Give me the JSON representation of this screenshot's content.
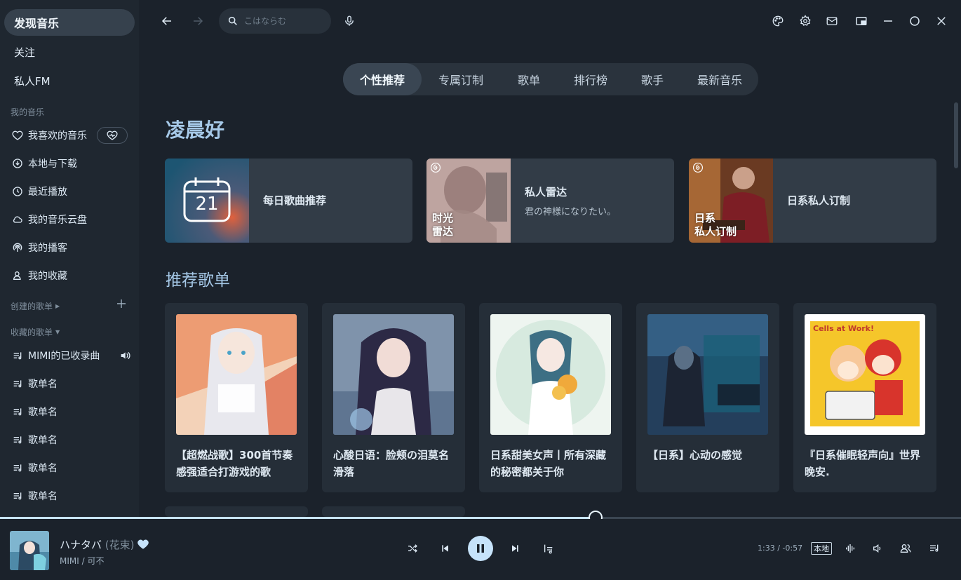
{
  "sidebar": {
    "nav": [
      {
        "label": "发现音乐",
        "active": true
      },
      {
        "label": "关注",
        "active": false
      },
      {
        "label": "私人FM",
        "active": false
      }
    ],
    "my_music_label": "我的音乐",
    "my_music": [
      {
        "label": "我喜欢的音乐",
        "icon": "heart-icon"
      },
      {
        "label": "本地与下载",
        "icon": "download-icon"
      },
      {
        "label": "最近播放",
        "icon": "clock-icon"
      },
      {
        "label": "我的音乐云盘",
        "icon": "cloud-icon"
      },
      {
        "label": "我的播客",
        "icon": "podcast-icon"
      },
      {
        "label": "我的收藏",
        "icon": "user-icon"
      }
    ],
    "created_label": "创建的歌单",
    "collected_label": "收藏的歌单",
    "playlists": [
      {
        "label": "MIMI的已收录曲"
      },
      {
        "label": "歌单名"
      },
      {
        "label": "歌单名"
      },
      {
        "label": "歌单名"
      },
      {
        "label": "歌单名"
      },
      {
        "label": "歌单名"
      }
    ]
  },
  "search": {
    "placeholder": "こはならむ"
  },
  "tabs": [
    {
      "label": "个性推荐",
      "active": true
    },
    {
      "label": "专属订制",
      "active": false
    },
    {
      "label": "歌单",
      "active": false
    },
    {
      "label": "排行榜",
      "active": false
    },
    {
      "label": "歌手",
      "active": false
    },
    {
      "label": "最新音乐",
      "active": false
    }
  ],
  "greeting": "凌晨好",
  "featured": [
    {
      "title": "每日歌曲推荐",
      "calendar_day": "21"
    },
    {
      "title": "私人雷达",
      "subtitle": "君の神様になりたい。",
      "thumb_text": [
        "时光",
        "雷达"
      ]
    },
    {
      "title": "日系私人订制",
      "thumb_text": [
        "日系",
        "私人订制"
      ]
    }
  ],
  "recommended_heading": "推荐歌单",
  "playlist_cards": [
    {
      "name": "【超燃战歌】300首节奏感强适合打游戏的歌"
    },
    {
      "name": "心酸日语：脸颊の泪莫名滑落"
    },
    {
      "name": "日系甜美女声丨所有深藏的秘密都关于你"
    },
    {
      "name": "【日系】心动の感觉"
    },
    {
      "name": "『日系催眠轻声向』世界晚安."
    }
  ],
  "cover_texts": {
    "cells_at_work": "Cells at Work!"
  },
  "player": {
    "title": "ハナタバ",
    "alias": "(花束)",
    "artist": "MIMI / 可不",
    "time": "1:33 / -0:57",
    "local_badge": "本地",
    "progress": 0.62
  },
  "colors": {
    "accent": "#c6e3fa",
    "heading": "#a6c9e8",
    "background": "#1b222b",
    "sidebar": "#1f2730",
    "card": "#323c47"
  }
}
